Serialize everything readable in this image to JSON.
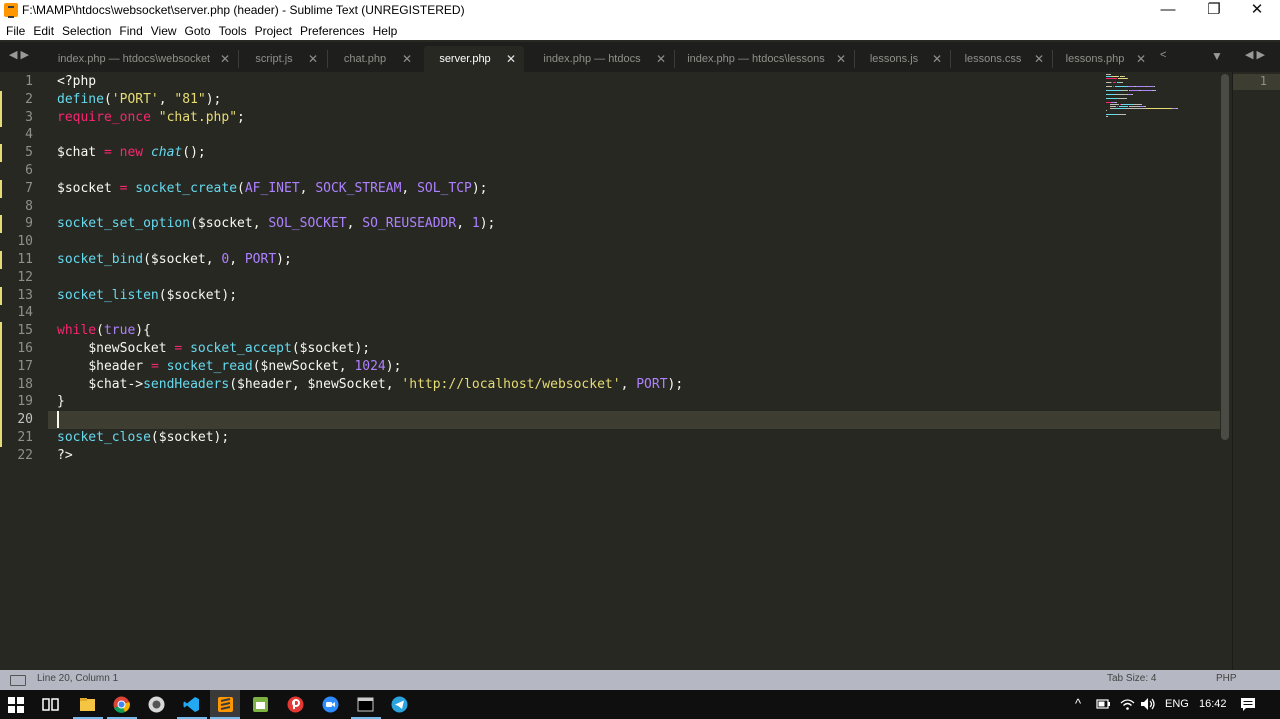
{
  "window": {
    "title": "F:\\MAMP\\htdocs\\websocket\\server.php (header) - Sublime Text (UNREGISTERED)",
    "controls": {
      "minimize": "—",
      "maximize": "❐",
      "close": "✕"
    }
  },
  "menu": [
    "File",
    "Edit",
    "Selection",
    "Find",
    "View",
    "Goto",
    "Tools",
    "Project",
    "Preferences",
    "Help"
  ],
  "tabs": [
    {
      "label": "index.php — htdocs\\websocket",
      "close": "✕"
    },
    {
      "label": "script.js",
      "close": "✕"
    },
    {
      "label": "chat.php",
      "close": "✕"
    },
    {
      "label": "server.php",
      "close": "✕",
      "active": true
    },
    {
      "label": "index.php — htdocs",
      "close": "✕"
    },
    {
      "label": "index.php — htdocs\\lessons",
      "close": "✕"
    },
    {
      "label": "lessons.js",
      "close": "✕"
    },
    {
      "label": "lessons.css",
      "close": "✕"
    },
    {
      "label": "lessons.php",
      "close": "✕"
    }
  ],
  "tabnav": {
    "left": "◀ ▶",
    "dropdown": "▼",
    "right": "◀ ▶",
    "overflow": "<"
  },
  "line_numbers": [
    "1",
    "2",
    "3",
    "4",
    "5",
    "6",
    "7",
    "8",
    "9",
    "10",
    "11",
    "12",
    "13",
    "14",
    "15",
    "16",
    "17",
    "18",
    "19",
    "20",
    "21",
    "22"
  ],
  "code": [
    [
      [
        "t-tag",
        "<?php"
      ]
    ],
    [
      [
        "t-fn",
        "define"
      ],
      [
        "t-pun",
        "("
      ],
      [
        "t-str",
        "'PORT'"
      ],
      [
        "t-pun",
        ", "
      ],
      [
        "t-str",
        "\"81\""
      ],
      [
        "t-pun",
        ");"
      ]
    ],
    [
      [
        "t-kw",
        "require_once"
      ],
      [
        "t-pun",
        " "
      ],
      [
        "t-str",
        "\"chat.php\""
      ],
      [
        "t-pun",
        ";"
      ]
    ],
    [],
    [
      [
        "t-var",
        "$chat"
      ],
      [
        "t-pun",
        " "
      ],
      [
        "t-op",
        "="
      ],
      [
        "t-pun",
        " "
      ],
      [
        "t-kw",
        "new"
      ],
      [
        "t-pun",
        " "
      ],
      [
        "t-cls",
        "chat"
      ],
      [
        "t-pun",
        "();"
      ]
    ],
    [],
    [
      [
        "t-var",
        "$socket"
      ],
      [
        "t-pun",
        " "
      ],
      [
        "t-op",
        "="
      ],
      [
        "t-pun",
        " "
      ],
      [
        "t-fn",
        "socket_create"
      ],
      [
        "t-pun",
        "("
      ],
      [
        "t-const",
        "AF_INET"
      ],
      [
        "t-pun",
        ", "
      ],
      [
        "t-const",
        "SOCK_STREAM"
      ],
      [
        "t-pun",
        ", "
      ],
      [
        "t-const",
        "SOL_TCP"
      ],
      [
        "t-pun",
        ");"
      ]
    ],
    [],
    [
      [
        "t-fn",
        "socket_set_option"
      ],
      [
        "t-pun",
        "("
      ],
      [
        "t-var",
        "$socket"
      ],
      [
        "t-pun",
        ", "
      ],
      [
        "t-const",
        "SOL_SOCKET"
      ],
      [
        "t-pun",
        ", "
      ],
      [
        "t-const",
        "SO_REUSEADDR"
      ],
      [
        "t-pun",
        ", "
      ],
      [
        "t-const",
        "1"
      ],
      [
        "t-pun",
        ");"
      ]
    ],
    [],
    [
      [
        "t-fn",
        "socket_bind"
      ],
      [
        "t-pun",
        "("
      ],
      [
        "t-var",
        "$socket"
      ],
      [
        "t-pun",
        ", "
      ],
      [
        "t-const",
        "0"
      ],
      [
        "t-pun",
        ", "
      ],
      [
        "t-const",
        "PORT"
      ],
      [
        "t-pun",
        ");"
      ]
    ],
    [],
    [
      [
        "t-fn",
        "socket_listen"
      ],
      [
        "t-pun",
        "("
      ],
      [
        "t-var",
        "$socket"
      ],
      [
        "t-pun",
        ");"
      ]
    ],
    [],
    [
      [
        "t-kw",
        "while"
      ],
      [
        "t-pun",
        "("
      ],
      [
        "t-const",
        "true"
      ],
      [
        "t-pun",
        "){"
      ]
    ],
    [
      [
        "t-pun",
        "    "
      ],
      [
        "t-var",
        "$newSocket"
      ],
      [
        "t-pun",
        " "
      ],
      [
        "t-op",
        "="
      ],
      [
        "t-pun",
        " "
      ],
      [
        "t-fn",
        "socket_accept"
      ],
      [
        "t-pun",
        "("
      ],
      [
        "t-var",
        "$socket"
      ],
      [
        "t-pun",
        ");"
      ]
    ],
    [
      [
        "t-pun",
        "    "
      ],
      [
        "t-var",
        "$header"
      ],
      [
        "t-pun",
        " "
      ],
      [
        "t-op",
        "="
      ],
      [
        "t-pun",
        " "
      ],
      [
        "t-fn",
        "socket_read"
      ],
      [
        "t-pun",
        "("
      ],
      [
        "t-var",
        "$newSocket"
      ],
      [
        "t-pun",
        ", "
      ],
      [
        "t-const",
        "1024"
      ],
      [
        "t-pun",
        ");"
      ]
    ],
    [
      [
        "t-pun",
        "    "
      ],
      [
        "t-var",
        "$chat"
      ],
      [
        "t-pun",
        "->"
      ],
      [
        "t-meth",
        "sendHeaders"
      ],
      [
        "t-pun",
        "("
      ],
      [
        "t-var",
        "$header"
      ],
      [
        "t-pun",
        ", "
      ],
      [
        "t-var",
        "$newSocket"
      ],
      [
        "t-pun",
        ", "
      ],
      [
        "t-str",
        "'http://localhost/websocket'"
      ],
      [
        "t-pun",
        ", "
      ],
      [
        "t-const",
        "PORT"
      ],
      [
        "t-pun",
        ");"
      ]
    ],
    [
      [
        "t-pun",
        "}"
      ]
    ],
    [],
    [
      [
        "t-fn",
        "socket_close"
      ],
      [
        "t-pun",
        "("
      ],
      [
        "t-var",
        "$socket"
      ],
      [
        "t-pun",
        ");"
      ]
    ],
    [
      [
        "t-tag",
        "?>"
      ]
    ]
  ],
  "cursor": {
    "line": 20
  },
  "modified_lines": [
    2,
    3,
    5,
    7,
    9,
    11,
    13,
    15,
    16,
    17,
    18,
    19,
    20,
    21
  ],
  "right_pane": {
    "line_number": "1"
  },
  "status": {
    "position": "Line 20, Column 1",
    "tab_size": "Tab Size: 4",
    "syntax": "PHP"
  },
  "taskbar": {
    "lang": "ENG",
    "time": "16:42",
    "tray_up": "^"
  },
  "colors": {
    "background": "#272822",
    "keyword": "#f92672",
    "function": "#66d9ef",
    "string": "#e6db74",
    "constant": "#ae81ff",
    "taskbar_accent": "#76b9ed"
  }
}
